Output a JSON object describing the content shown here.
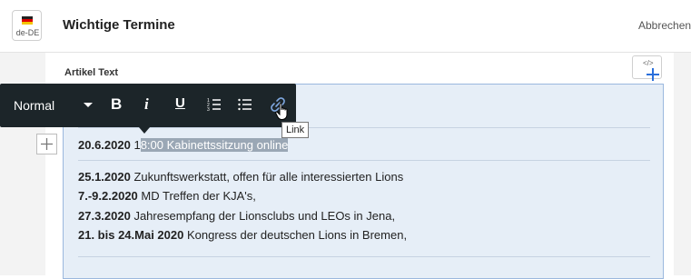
{
  "header": {
    "lang_code": "de-DE",
    "title": "Wichtige Termine",
    "cancel_label": "Abbrechen"
  },
  "field": {
    "label": "Artikel Text",
    "code_icon": "code-icon",
    "add_icon": "plus-icon"
  },
  "toolbar": {
    "format": "Normal",
    "bold": "B",
    "italic": "i",
    "underline": "U",
    "ordered_list_icon": "ordered-list-icon",
    "bullet_list_icon": "bullet-list-icon",
    "link_icon": "link-icon",
    "tooltip": "Link"
  },
  "content": {
    "first": {
      "date": "20.6.2020",
      "pre": " 1",
      "selected": "8:00 Kabinettssitzung online"
    },
    "events": [
      {
        "date": "25.1.2020",
        "text": " Zukunftswerkstatt, offen für alle interessierten Lions"
      },
      {
        "date": "7.-9.2.2020",
        "text": " MD Treffen der KJA's,"
      },
      {
        "date": "27.3.2020",
        "text": " Jahresempfang der Lionsclubs und LEOs in Jena,"
      },
      {
        "date": "21. bis 24.Mai 2020",
        "text": " Kongress der deutschen Lions in Bremen,"
      }
    ]
  },
  "colors": {
    "toolbar_bg": "#1c2529",
    "editor_bg": "#e6eef7",
    "editor_border": "#9bb8de",
    "selection": "#9aa7b5",
    "accent": "#2a6fdb"
  }
}
